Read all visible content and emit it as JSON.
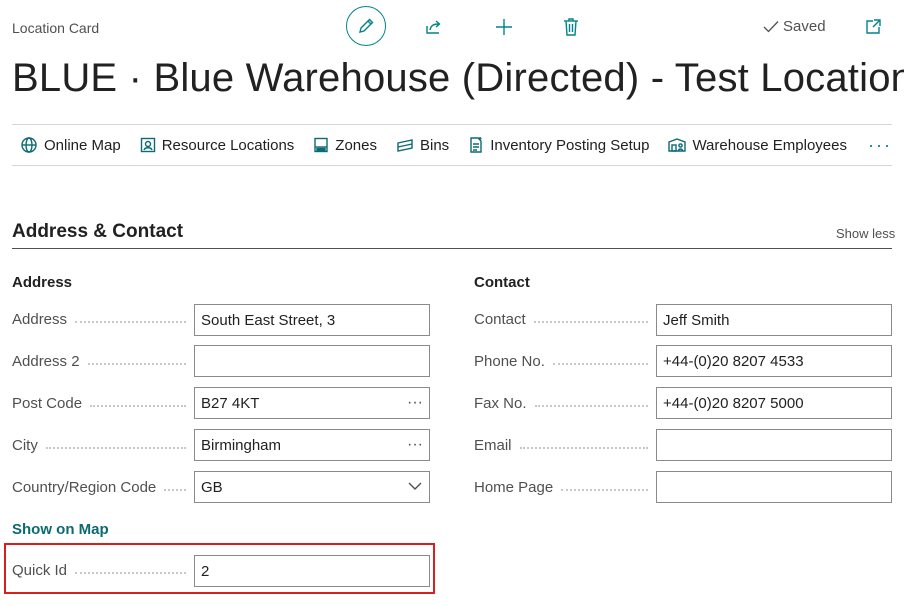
{
  "header": {
    "caption": "Location Card",
    "saved_label": "Saved",
    "title": "BLUE · Blue Warehouse (Directed) - Test Location"
  },
  "actions": [
    {
      "label": "Online Map",
      "icon": "globe-icon"
    },
    {
      "label": "Resource Locations",
      "icon": "resource-location-icon"
    },
    {
      "label": "Zones",
      "icon": "zones-icon"
    },
    {
      "label": "Bins",
      "icon": "bins-icon"
    },
    {
      "label": "Inventory Posting Setup",
      "icon": "posting-setup-icon"
    },
    {
      "label": "Warehouse Employees",
      "icon": "warehouse-employees-icon"
    }
  ],
  "more_label": "···",
  "section": {
    "title": "Address & Contact",
    "toggle_label": "Show less"
  },
  "address": {
    "heading": "Address",
    "fields": [
      {
        "label": "Address",
        "value": "South East Street, 3"
      },
      {
        "label": "Address 2",
        "value": ""
      },
      {
        "label": "Post Code",
        "value": "B27 4KT"
      },
      {
        "label": "City",
        "value": "Birmingham"
      },
      {
        "label": "Country/Region Code",
        "value": "GB"
      }
    ],
    "show_on_map": "Show on Map",
    "quick_id": {
      "label": "Quick Id",
      "value": "2"
    }
  },
  "contact": {
    "heading": "Contact",
    "fields": [
      {
        "label": "Contact",
        "value": "Jeff Smith"
      },
      {
        "label": "Phone No.",
        "value": "+44-(0)20 8207 4533"
      },
      {
        "label": "Fax No.",
        "value": "+44-(0)20 8207 5000"
      },
      {
        "label": "Email",
        "value": ""
      },
      {
        "label": "Home Page",
        "value": ""
      }
    ]
  },
  "colors": {
    "accent": "#008489",
    "link": "#0b6a73",
    "highlight": "#d6201c"
  }
}
